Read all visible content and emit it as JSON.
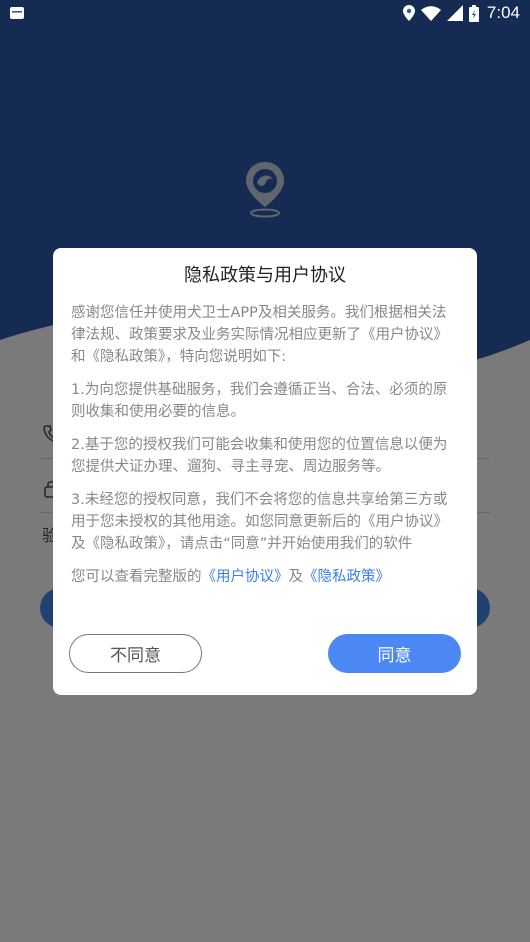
{
  "status_bar": {
    "time": "7:04",
    "icons": [
      "app-notification-icon",
      "location-icon",
      "wifi-icon",
      "cellular-signal-icon",
      "battery-icon"
    ]
  },
  "background": {
    "verify_label_fragment": "验"
  },
  "dialog": {
    "title": "隐私政策与用户协议",
    "paragraphs": [
      "感谢您信任并使用犬卫士APP及相关服务。我们根据相关法律法规、政策要求及业务实际情况相应更新了《用户协议》和《隐私政策》，特向您说明如下:",
      "1.为向您提供基础服务，我们会遵循正当、合法、必须的原则收集和使用必要的信息。",
      "2.基于您的授权我们可能会收集和使用您的位置信息以便为您提供犬证办理、遛狗、寻主寻宠、周边服务等。",
      "3.未经您的授权同意，我们不会将您的信息共享给第三方或用于您未授权的其他用途。如您同意更新后的《用户协议》及《隐私政策》，请点击“同意”并开始使用我们的软件"
    ],
    "links_prefix": "您可以查看完整版的",
    "user_agreement_link": "《用户协议》",
    "links_conjunction": "及",
    "privacy_policy_link": "《隐私政策》",
    "disagree_label": "不同意",
    "agree_label": "同意"
  },
  "colors": {
    "brand_blue": "#2c5ab0",
    "accent": "#4b88f3",
    "link": "#3b7ded"
  }
}
